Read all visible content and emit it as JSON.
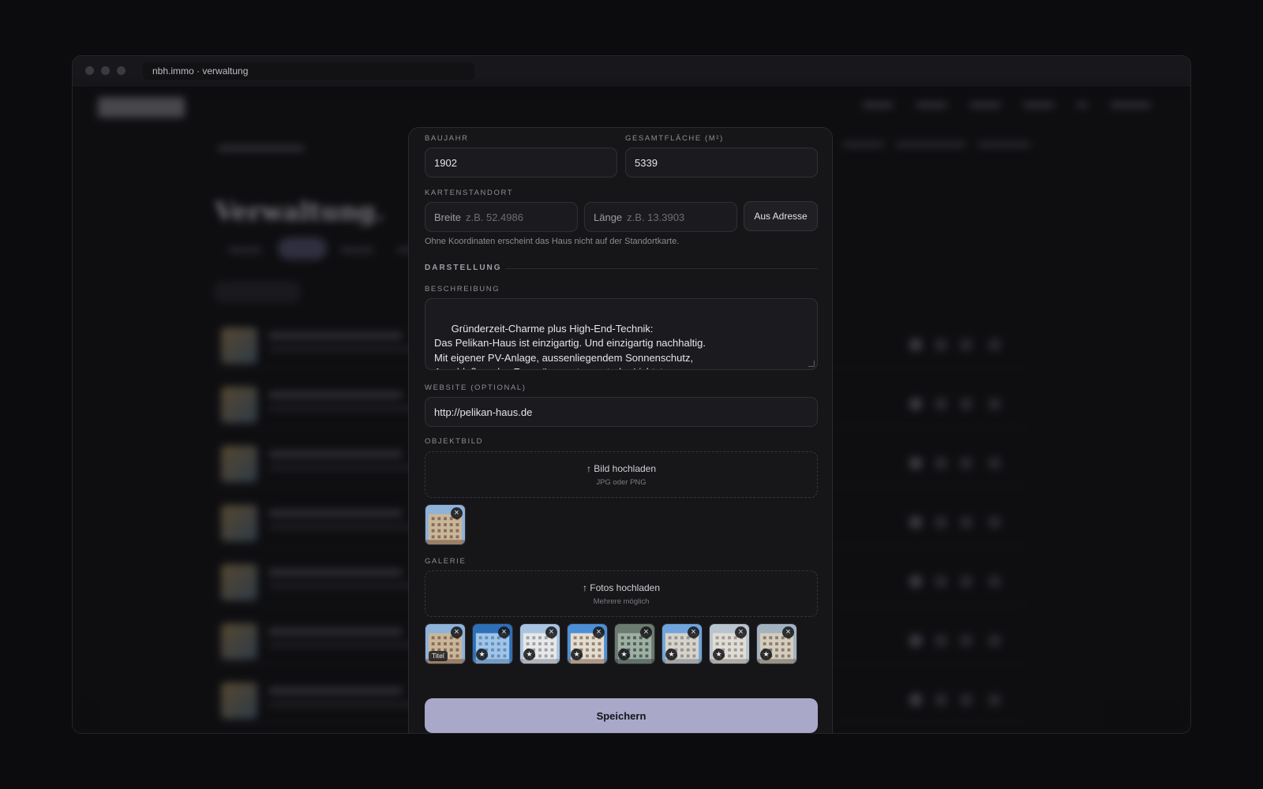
{
  "browser": {
    "url": "nbh.immo · verwaltung"
  },
  "background": {
    "title": "Verwaltung."
  },
  "form": {
    "baujahr": {
      "label": "BAUJAHR",
      "value": "1902"
    },
    "gesamtflaeche": {
      "label": "GESAMTFLÄCHE (M²)",
      "value": "5339"
    },
    "kartenstandort": {
      "label": "KARTENSTANDORT",
      "breite_label": "Breite",
      "breite_placeholder": "z.B. 52.4986",
      "laenge_label": "Länge",
      "laenge_placeholder": "z.B. 13.3903",
      "button": "Aus Adresse",
      "hint": "Ohne Koordinaten erscheint das Haus nicht auf der Standortkarte."
    },
    "darstellung": {
      "heading": "DARSTELLUNG"
    },
    "beschreibung": {
      "label": "BESCHREIBUNG",
      "value": "Gründerzeit-Charme plus High-End-Technik:\nDas Pelikan-Haus ist einzigartig. Und einzigartig nachhaltig.\nMit eigener PV-Anlage, aussenliegendem Sonnenschutz,\nAnschluß an das Fernwärmenetz, zentraler Lichtsteuerung\nbis LED-Beleuchtung und einer hocheffizienten KWK-Anlage"
    },
    "website": {
      "label": "WEBSITE (OPTIONAL)",
      "value": "http://pelikan-haus.de"
    },
    "objektbild": {
      "label": "OBJEKTBILD",
      "upload_title": "↑ Bild hochladen",
      "upload_sub": "JPG oder PNG"
    },
    "galerie": {
      "label": "GALERIE",
      "upload_title": "↑ Fotos hochladen",
      "upload_sub": "Mehrere möglich",
      "titel_badge": "Titel",
      "count": 8
    },
    "save": "Speichern"
  },
  "icons": {
    "remove": "close-icon",
    "star": "star-icon",
    "upload": "upload-arrow-icon"
  },
  "colors": {
    "accent": "#a9a8c8",
    "modal_bg": "#161619",
    "input_bg": "#1b1b1f"
  }
}
